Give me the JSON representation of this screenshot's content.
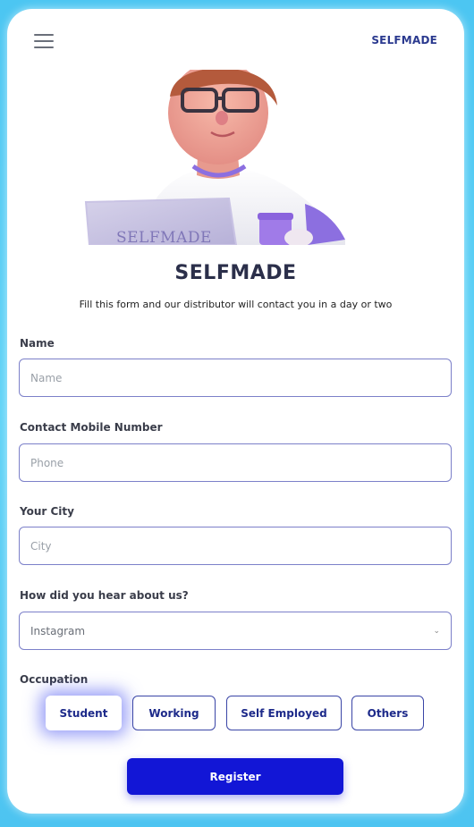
{
  "header": {
    "brand": "SELFMADE",
    "menu_icon": "hamburger-menu-icon"
  },
  "hero": {
    "laptop_text": "SELFMADE"
  },
  "page": {
    "title": "SELFMADE",
    "subtitle": "Fill this form and our distributor will contact you in a day or two"
  },
  "form": {
    "name": {
      "label": "Name",
      "placeholder": "Name",
      "value": ""
    },
    "phone": {
      "label": "Contact Mobile Number",
      "placeholder": "Phone",
      "value": ""
    },
    "city": {
      "label": "Your City",
      "placeholder": "City",
      "value": ""
    },
    "source": {
      "label": "How did you hear about us?",
      "selected": "Instagram"
    },
    "occupation": {
      "label": "Occupation",
      "options": [
        "Student",
        "Working",
        "Self Employed",
        "Others"
      ],
      "selected": "Student"
    },
    "submit_label": "Register"
  },
  "colors": {
    "background": "#4cc6f2",
    "accent": "#1216d6",
    "input_border": "#7c80c9",
    "title": "#2b2f4a"
  }
}
